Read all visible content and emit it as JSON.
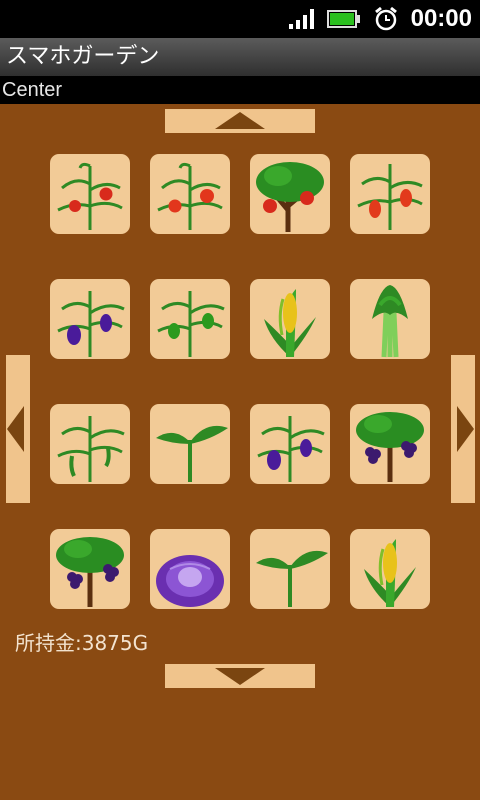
{
  "status": {
    "time": "00:00"
  },
  "app": {
    "title": "スマホガーデン",
    "location": "Center"
  },
  "money": {
    "label": "所持金:3875G"
  },
  "garden": {
    "rows": [
      [
        "tomato-plant",
        "tomato-plant",
        "apple-tree",
        "pepper-plant"
      ],
      [
        "eggplant-plant",
        "green-pepper-plant",
        "corn-plant",
        "celery-plant"
      ],
      [
        "bean-plant",
        "sprout",
        "eggplant-plant",
        "grape-tree"
      ],
      [
        "grape-tree",
        "red-cabbage",
        "sprout",
        "corn-plant"
      ]
    ]
  },
  "colors": {
    "background": "#8a4a12",
    "button": "#f0c48c",
    "tile": "#f2cb97",
    "arrow": "#7a4510"
  }
}
